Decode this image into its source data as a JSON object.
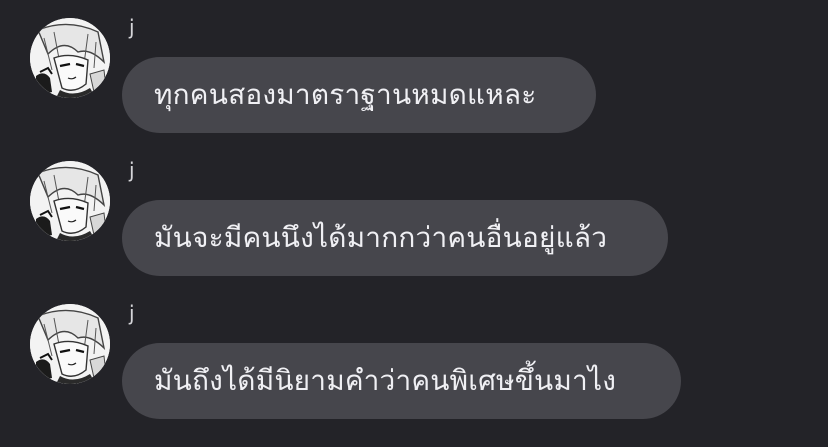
{
  "messages": [
    {
      "sender": "j",
      "avatar_icon": "manga-character-avatar",
      "text": "ทุกคนสองมาตราฐานหมดแหละ"
    },
    {
      "sender": "j",
      "avatar_icon": "manga-character-avatar",
      "text": "มันจะมีคนนึงได้มากกว่าคนอื่นอยู่แล้ว"
    },
    {
      "sender": "j",
      "avatar_icon": "manga-character-avatar",
      "text": "มันถึงได้มีนิยามคำว่าคนพิเศษขึ้นมาไง"
    }
  ],
  "colors": {
    "background": "#232328",
    "bubble": "#46464c",
    "text": "#f0f0f4"
  }
}
